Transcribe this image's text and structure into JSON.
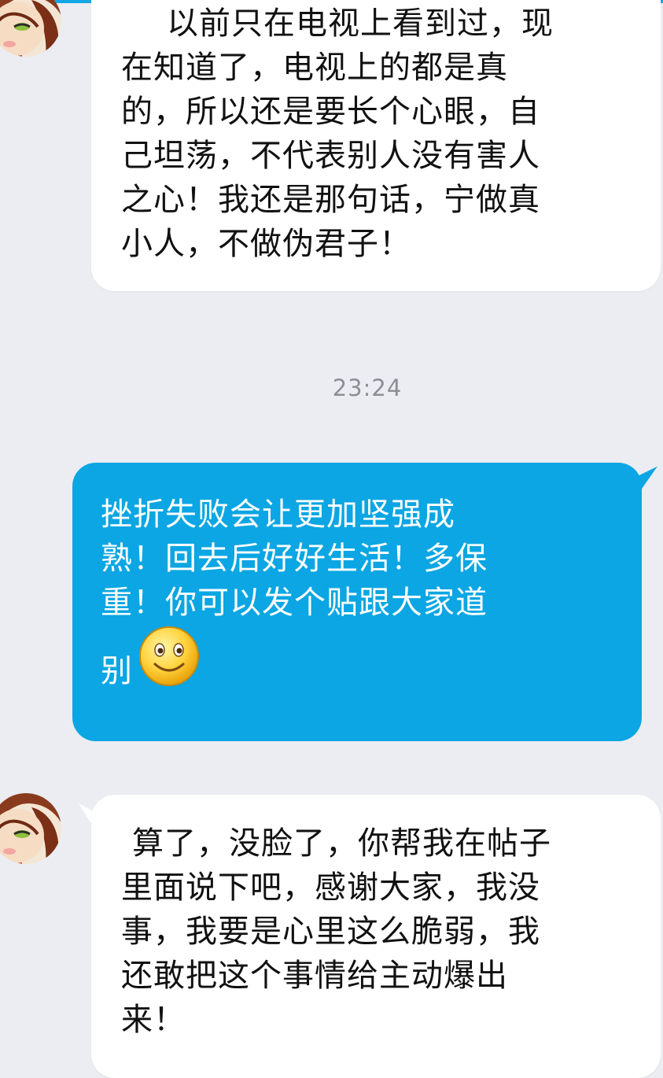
{
  "chat": {
    "messages": [
      {
        "sender": "them",
        "lines": [
          "以前只在电视上看到过，现",
          "在知道了，电视上的都是真",
          "的，所以还是要长个心眼，自",
          "己坦荡，不代表别人没有害人",
          "之心！我还是那句话，宁做真",
          "小人，不做伪君子！"
        ]
      },
      {
        "sender": "me",
        "lines": [
          "挫折失败会让更加坚强成",
          "熟！回去后好好生活！多保",
          "重！你可以发个贴跟大家道",
          "别"
        ],
        "emoji": "smiley-face-icon"
      },
      {
        "sender": "them",
        "lines": [
          "算了，没脸了，你帮我在帖子",
          "里面说下吧，感谢大家，我没",
          "事，我要是心里这么脆弱，我",
          "还敢把这个事情给主动爆出",
          "来！"
        ]
      }
    ],
    "timestamp": "23:24"
  },
  "colors": {
    "background": "#ebedf2",
    "incoming_bubble": "#ffffff",
    "outgoing_bubble": "#0ba6e3",
    "timestamp_text": "#8b8f96"
  }
}
